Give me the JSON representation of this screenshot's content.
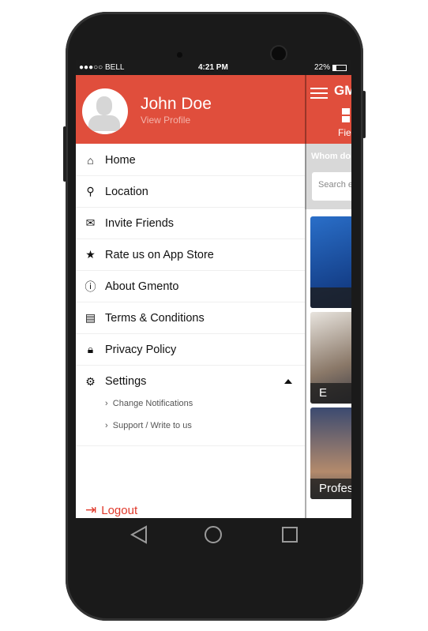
{
  "status_bar": {
    "carrier": "●●●○○ BELL",
    "time": "4:21 PM",
    "battery": "22%",
    "battery_level": 0.22
  },
  "profile": {
    "name": "John Doe",
    "link": "View Profile"
  },
  "menu": [
    {
      "label": "Home",
      "icon": "home-icon"
    },
    {
      "label": "Location",
      "icon": "map-pin-icon"
    },
    {
      "label": "Invite Friends",
      "icon": "envelope-icon"
    },
    {
      "label": "Rate us on App Store",
      "icon": "star-icon"
    },
    {
      "label": "About Gmento",
      "icon": "info-icon"
    },
    {
      "label": "Terms & Conditions",
      "icon": "document-icon"
    },
    {
      "label": "Privacy Policy",
      "icon": "lock-icon"
    },
    {
      "label": "Settings",
      "icon": "gear-icon"
    }
  ],
  "settings_sub": [
    "Change Notifications",
    "Support / Write to us"
  ],
  "logout": "Logout",
  "background": {
    "app_title": "GM",
    "tab": "Fie",
    "prompt": "Whom do",
    "search_placeholder": "Search e",
    "cards": [
      "",
      "E",
      "Profes"
    ]
  },
  "colors": {
    "accent": "#e04e3c",
    "logout": "#e0392b"
  }
}
